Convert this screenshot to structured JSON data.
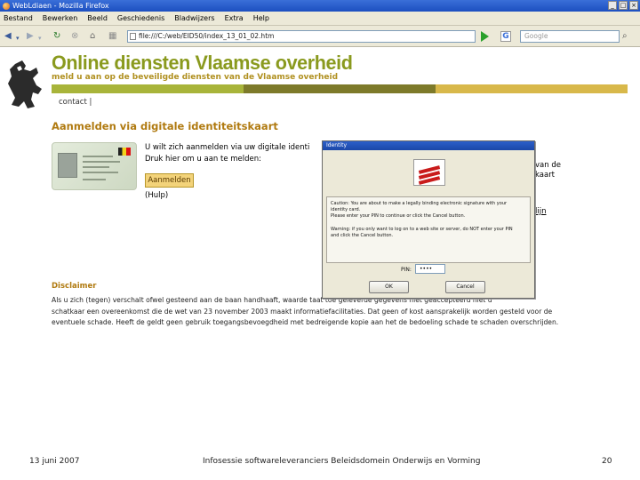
{
  "browser": {
    "window_title": "WebLdiaen - Mozilla Firefox",
    "menu": [
      "Bestand",
      "Bewerken",
      "Beeld",
      "Geschiedenis",
      "Bladwijzers",
      "Extra",
      "Help"
    ],
    "url": "file:///C:/web/EID50/index_13_01_02.htm",
    "search_placeholder": "Google"
  },
  "page": {
    "title": "Online diensten Vlaamse overheid",
    "subtitle": "meld u aan op de beveiligde diensten van de Vlaamse overheid",
    "bar_colors": [
      "#a8b43a",
      "#7d7a2a",
      "#d8b84a"
    ],
    "contact": "contact  |",
    "heading": "Aanmelden via digitale identiteitskaart",
    "intro_line1": "U wilt zich aanmelden via uw digitale identi",
    "intro_line2": "Druk hier om u aan te melden:",
    "login_button": "Aanmelden",
    "help_link": "(Hulp)",
    "side_line1": "van de",
    "side_line2": "kaart",
    "side_link": "lijn",
    "disclaimer_title": "Disclaimer",
    "disclaimer_lines": [
      "Als u zich (tegen) verschalt ofwel gesteend aan de baan handhaaft, waarde taat toe geleverde gegevens niet geaccepteerd niet u",
      "schatkaar een overeenkomst die de wet van 23 november 2003 maakt informatiefacilitaties. Dat geen of kost aansprakelijk worden gesteld voor de",
      "eventuele schade. Heeft de geldt geen gebruik toegangsbevoegdheid met bedreigende kopie aan het de bedoeling schade te schaden overschrijden."
    ]
  },
  "dialog": {
    "title": "Identity",
    "caution_line1": "Caution: You are about to make a legally binding electronic signature with your",
    "caution_line2": "identity card.",
    "caution_line3": "Please enter your PIN to continue or click the Cancel button.",
    "warning_line1": "Warning: if you only want to log on to a web site or server, do NOT enter your PIN",
    "warning_line2": "and click the Cancel button.",
    "pin_label": "PIN:",
    "pin_value": "••••",
    "ok_label": "OK",
    "cancel_label": "Cancel"
  },
  "footer": {
    "date": "13 juni 2007",
    "caption": "Infosessie softwareleveranciers Beleidsdomein Onderwijs en Vorming",
    "page_number": "20"
  }
}
